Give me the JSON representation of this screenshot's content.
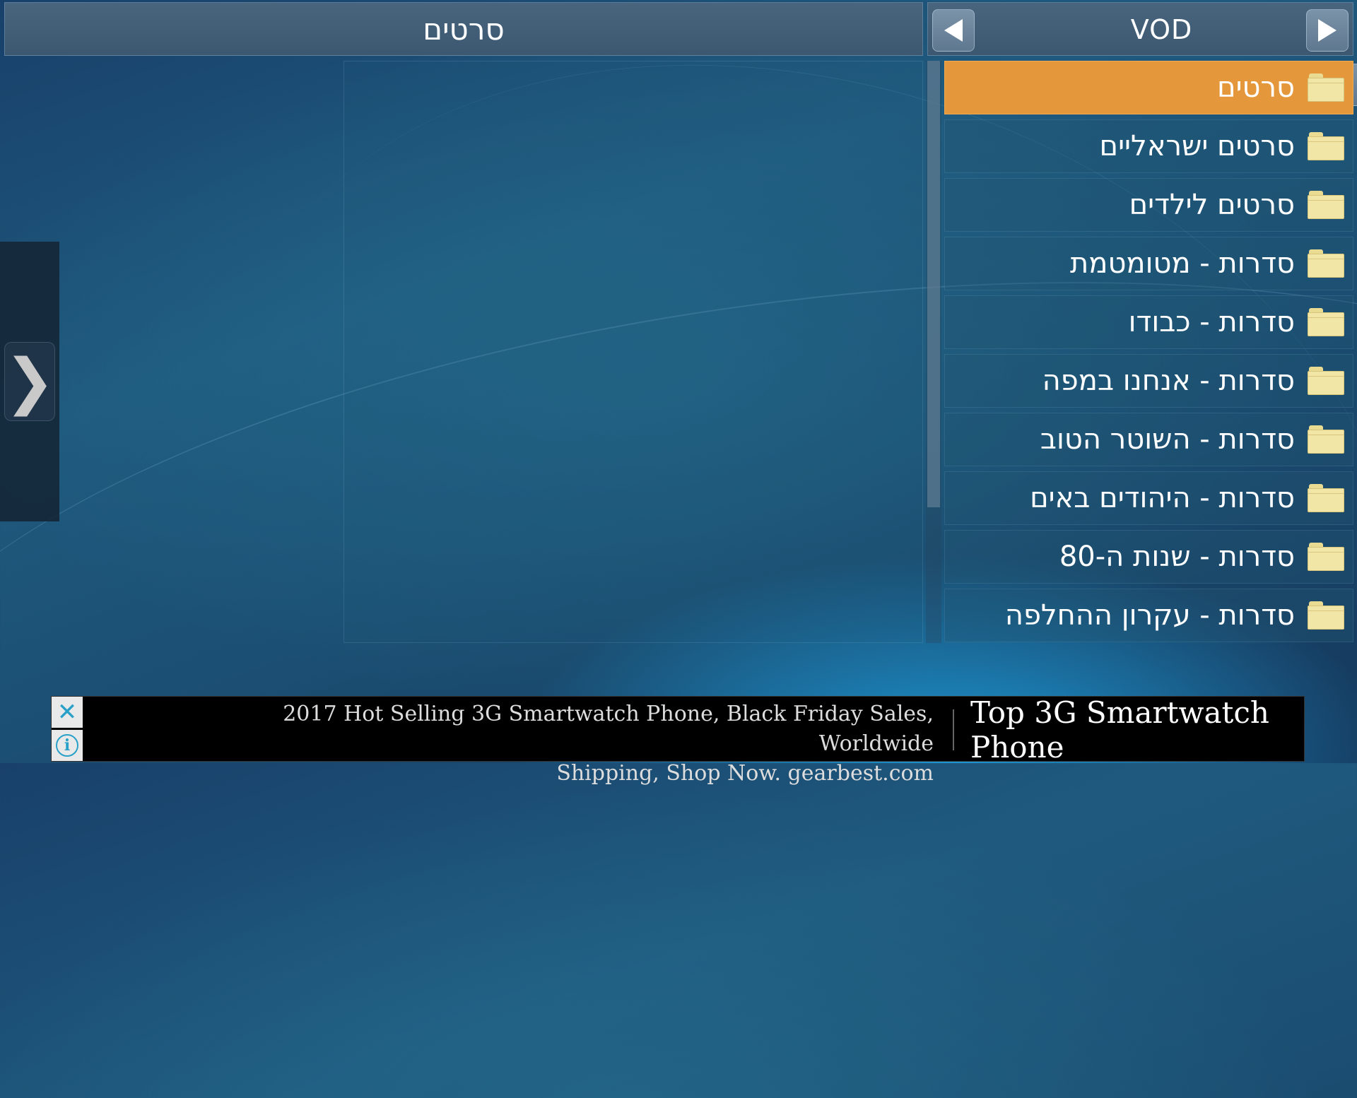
{
  "left_header": {
    "title": "סרטים"
  },
  "right_header": {
    "title": "VOD"
  },
  "side_tab": {
    "glyph": "❯"
  },
  "list": {
    "items": [
      {
        "label": "סרטים",
        "selected": true
      },
      {
        "label": "סרטים ישראליים"
      },
      {
        "label": "סרטים לילדים"
      },
      {
        "label": "סדרות - מטומטמת"
      },
      {
        "label": "סדרות - כבודו"
      },
      {
        "label": "סדרות - אנחנו במפה"
      },
      {
        "label": "סדרות - השוטר הטוב"
      },
      {
        "label": "סדרות - היהודים באים"
      },
      {
        "label": "סדרות - שנות ה-80"
      },
      {
        "label": "סדרות - עקרון ההחלפה"
      }
    ]
  },
  "ad": {
    "text_line1": "2017 Hot Selling 3G Smartwatch Phone, Black Friday Sales, Worldwide",
    "text_line2": "Shipping, Shop Now. gearbest.com",
    "cta": "Top 3G Smartwatch Phone"
  },
  "colors": {
    "selected_row": "#e5973b",
    "folder": "#f2e6a6",
    "header": "#49657e",
    "ad_icon": "#29a0c8"
  }
}
